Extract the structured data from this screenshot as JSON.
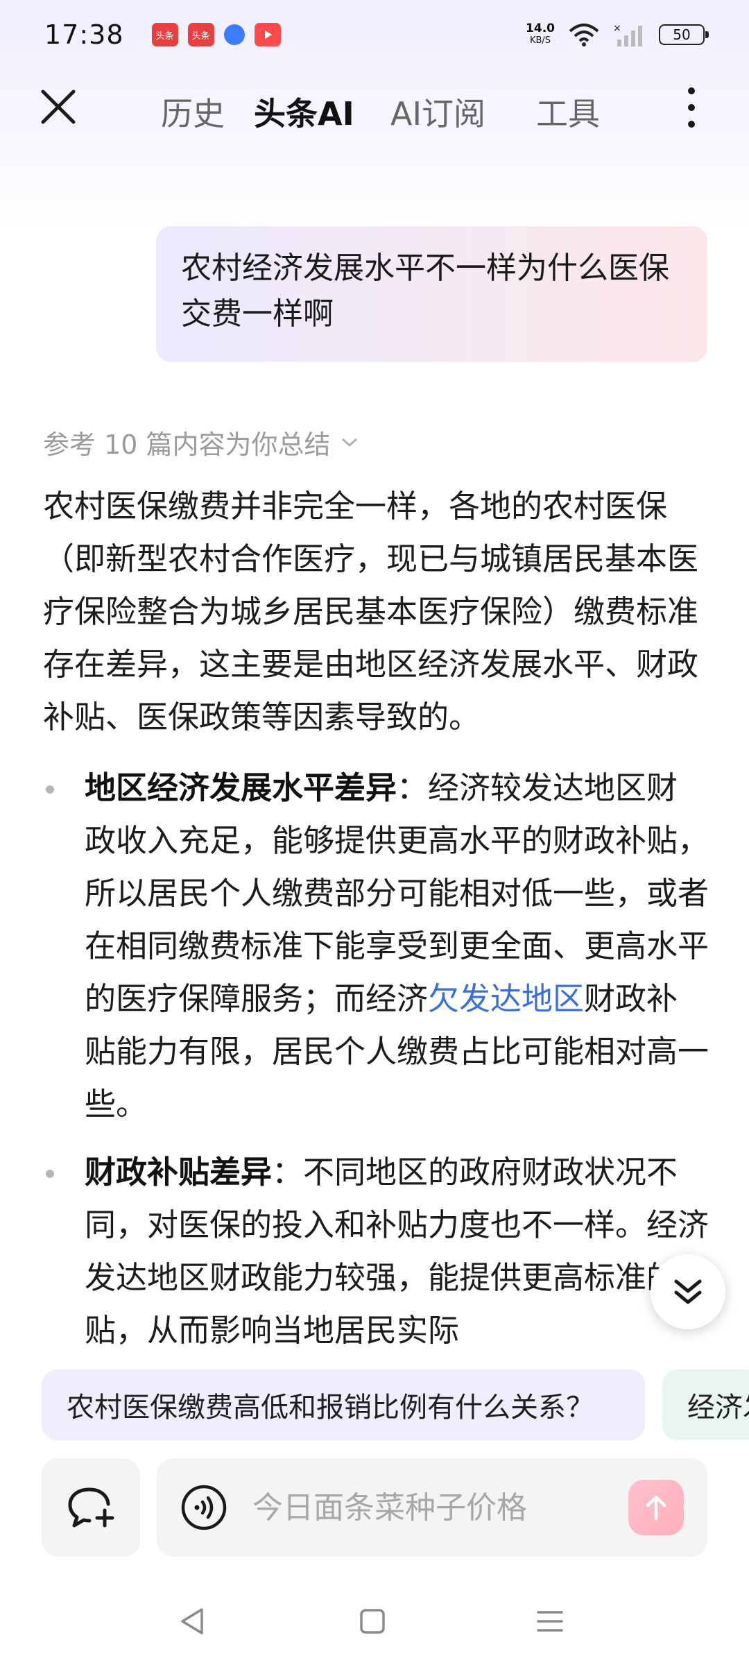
{
  "status_bar": {
    "time": "17:38",
    "notifications": [
      "头条",
      "头条"
    ],
    "net_speed_value": "14.0",
    "net_speed_unit": "KB/S",
    "battery": "50"
  },
  "nav": {
    "tabs": [
      {
        "label": "历史",
        "active": false
      },
      {
        "label": "头条AI",
        "active": true
      },
      {
        "label": "AI订阅",
        "active": false
      },
      {
        "label": "工具",
        "active": false
      }
    ]
  },
  "question": "农村经济发展水平不一样为什么医保交费一样啊",
  "reference": "参考 10 篇内容为你总结",
  "answer": {
    "intro": "农村医保缴费并非完全一样，各地的农村医保（即新型农村合作医疗，现已与城镇居民基本医疗保险整合为城乡居民基本医疗保险）缴费标准存在差异，这主要是由地区经济发展水平、财政补贴、医保政策等因素导致的。",
    "bullets": [
      {
        "title": "地区经济发展水平差异",
        "sep": "：",
        "text_before_link": "经济较发达地区财政收入充足，能够提供更高水平的财政补贴，所以居民个人缴费部分可能相对低一些，或者在相同缴费标准下能享受到更全面、更高水平的医疗保障服务；而经济",
        "link": "欠发达地区",
        "text_after_link": "财政补贴能力有限，居民个人缴费占比可能相对高一些。"
      },
      {
        "title": "财政补贴差异",
        "sep": "：",
        "text": "不同地区的政府财政状况不同，对医保的投入和补贴力度也不一样。经济发达地区财政能力较强，能提供更高标准的补贴，从而影响当地居民实际"
      }
    ]
  },
  "suggestions": [
    "农村医保缴费高低和报销比例有什么关系？",
    "经济发"
  ],
  "input": {
    "placeholder": "今日面条菜种子价格"
  },
  "colors": {
    "link": "#3a6fd8",
    "accent_gradient_start": "#eceaff",
    "accent_gradient_end": "#fde6ea"
  }
}
